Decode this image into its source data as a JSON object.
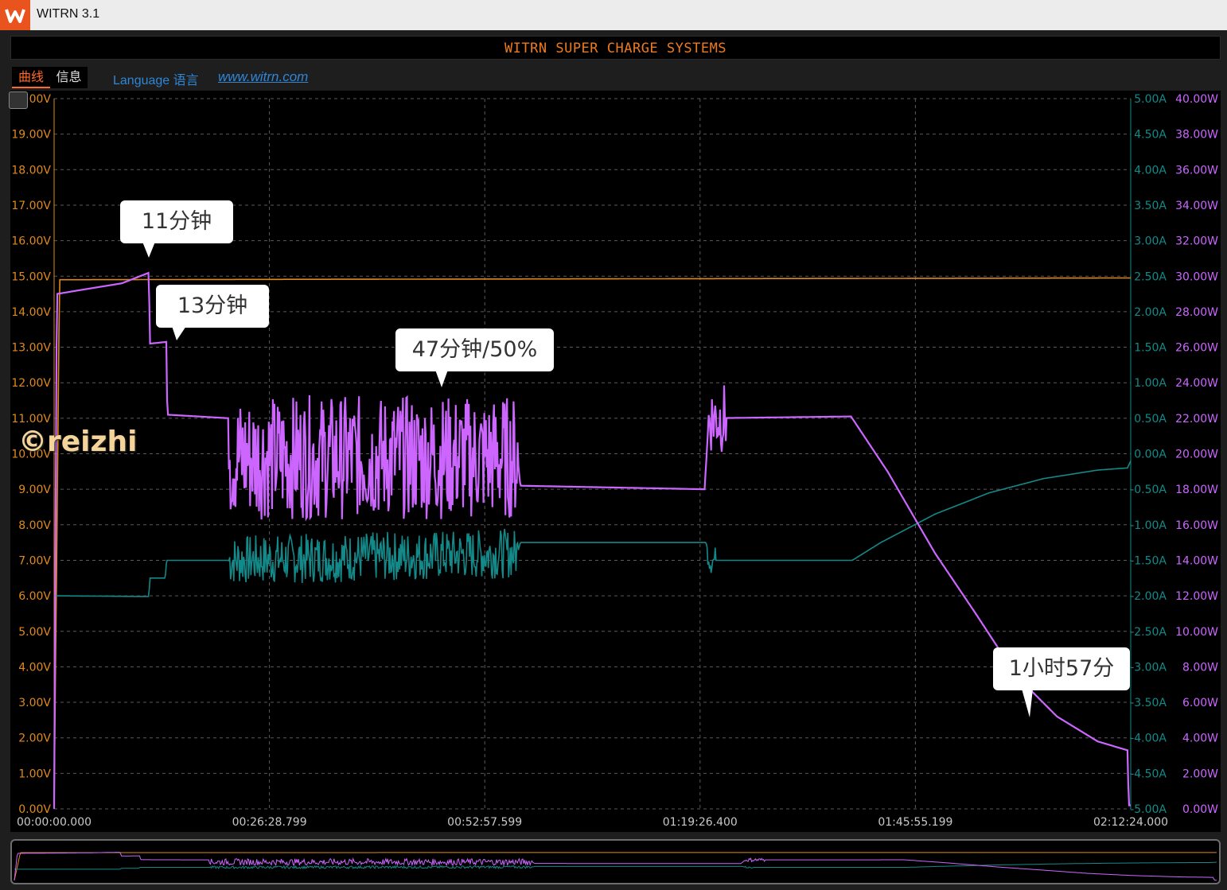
{
  "window": {
    "title": "WITRN 3.1",
    "logo": "witrn-logo-icon"
  },
  "banner": {
    "text": "WITRN SUPER CHARGE SYSTEMS"
  },
  "tabs": [
    {
      "label": "曲线",
      "active": true
    },
    {
      "label": "信息",
      "active": false
    }
  ],
  "links": {
    "language": "Language 语言",
    "site": "www.witrn.com"
  },
  "watermark": "©reizhi",
  "callouts": [
    {
      "label": "11分钟"
    },
    {
      "label": "13分钟"
    },
    {
      "label": "47分钟/50%"
    },
    {
      "label": "1小时57分"
    }
  ],
  "colors": {
    "voltage": "#e0891a",
    "current": "#138a89",
    "power": "#cc66ff",
    "axis_left": "#e0891a",
    "axis_current": "#138a89",
    "axis_power": "#cc66ff",
    "time_axis": "#c8c8c8",
    "accent": "#ff6a2a"
  },
  "chart_data": {
    "type": "line",
    "x_ticks": [
      "00:00:00.000",
      "00:26:28.799",
      "00:52:57.599",
      "01:19:26.400",
      "01:45:55.199",
      "02:12:24.000"
    ],
    "x_range_seconds": [
      0,
      7944
    ],
    "axes": {
      "voltage": {
        "label_ticks": [
          "0.00V",
          "1.00V",
          "2.00V",
          "3.00V",
          "4.00V",
          "5.00V",
          "6.00V",
          "7.00V",
          "8.00V",
          "9.00V",
          "10.00V",
          "11.00V",
          "12.00V",
          "13.00V",
          "14.00V",
          "15.00V",
          "16.00V",
          "17.00V",
          "18.00V",
          "19.00V",
          "20.00V"
        ],
        "range": [
          0,
          20
        ]
      },
      "current": {
        "label_ticks": [
          "-5.00A",
          "-4.50A",
          "-4.00A",
          "-3.50A",
          "-3.00A",
          "-2.50A",
          "-2.00A",
          "-1.50A",
          "-1.00A",
          "-0.50A",
          "0.00A",
          "0.50A",
          "1.00A",
          "1.50A",
          "2.00A",
          "2.50A",
          "3.00A",
          "3.50A",
          "4.00A",
          "4.50A",
          "5.00A"
        ],
        "range": [
          -5,
          5
        ]
      },
      "power": {
        "label_ticks": [
          "0.00W",
          "2.00W",
          "4.00W",
          "6.00W",
          "8.00W",
          "10.00W",
          "12.00W",
          "14.00W",
          "16.00W",
          "18.00W",
          "20.00W",
          "22.00W",
          "24.00W",
          "26.00W",
          "28.00W",
          "30.00W",
          "32.00W",
          "34.00W",
          "36.00W",
          "38.00W",
          "40.00W"
        ],
        "range": [
          0,
          40
        ]
      }
    },
    "series": [
      {
        "key": "voltage",
        "axis": "voltage",
        "points": [
          [
            0,
            0
          ],
          [
            40,
            14.9
          ],
          [
            7944,
            14.95
          ]
        ]
      },
      {
        "key": "current",
        "axis": "current",
        "points": [
          [
            0,
            -2.0
          ],
          [
            700,
            -2.01
          ],
          [
            705,
            -1.75
          ],
          [
            820,
            -1.75
          ],
          [
            830,
            -1.5
          ],
          [
            1290,
            -1.5
          ],
          [
            3420,
            -1.4
          ],
          [
            3440,
            -1.25
          ],
          [
            4810,
            -1.25
          ],
          [
            4840,
            -1.5
          ],
          [
            5890,
            -1.5
          ],
          [
            6100,
            -1.25
          ],
          [
            6500,
            -0.85
          ],
          [
            6900,
            -0.55
          ],
          [
            7300,
            -0.35
          ],
          [
            7700,
            -0.23
          ],
          [
            7920,
            -0.2
          ],
          [
            7944,
            -0.1
          ]
        ],
        "noisy_ranges": [
          [
            1290,
            3420,
            0.35
          ],
          [
            4820,
            4880,
            0.2
          ]
        ]
      },
      {
        "key": "power",
        "axis": "power",
        "points": [
          [
            0,
            0
          ],
          [
            20,
            29.0
          ],
          [
            500,
            29.6
          ],
          [
            700,
            30.2
          ],
          [
            705,
            26.2
          ],
          [
            830,
            26.3
          ],
          [
            835,
            22.2
          ],
          [
            1290,
            22.0
          ],
          [
            1300,
            19.8
          ],
          [
            3420,
            19.8
          ],
          [
            3440,
            18.2
          ],
          [
            4800,
            18.0
          ],
          [
            4830,
            22.0
          ],
          [
            5880,
            22.1
          ],
          [
            6150,
            19.0
          ],
          [
            6500,
            14.4
          ],
          [
            6800,
            11.0
          ],
          [
            7100,
            7.5
          ],
          [
            7400,
            5.2
          ],
          [
            7700,
            3.8
          ],
          [
            7920,
            3.3
          ],
          [
            7930,
            0.2
          ]
        ],
        "noisy_ranges": [
          [
            1290,
            3420,
            3.5
          ],
          [
            4830,
            4960,
            2.0
          ]
        ]
      }
    ],
    "annotations": [
      {
        "label": "11分钟",
        "x": 700,
        "power": 30.2
      },
      {
        "label": "13分钟",
        "x": 830,
        "power": 26.3
      },
      {
        "label": "47分钟/50%",
        "x": 2840,
        "power": 23.5
      },
      {
        "label": "1小时57分",
        "x": 7020,
        "power": 5.9
      }
    ],
    "grid": true,
    "legend": "none"
  }
}
